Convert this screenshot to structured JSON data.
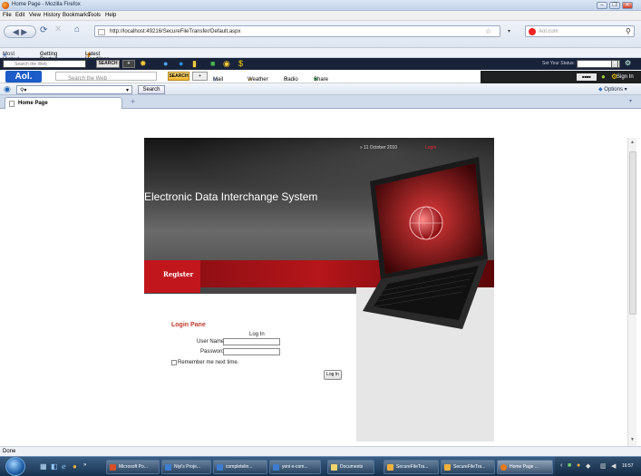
{
  "window": {
    "title": "Home Page - Mozilla Firefox"
  },
  "menu": [
    "File",
    "Edit",
    "View",
    "History",
    "Bookmarks",
    "Tools",
    "Help"
  ],
  "nav": {
    "url": "http://localhost:49216/SecureFileTransfer/Default.aspx",
    "search_placeholder": "Aol.com"
  },
  "bookmarks": [
    "Most Visited",
    "Getting Started",
    "Latest Headlines"
  ],
  "toolbar1": {
    "search_placeholder": "Search the Web",
    "search_btn": "SEARCH",
    "status_label": "Set Your Status:"
  },
  "toolbar2": {
    "logo": "Aol.",
    "search_placeholder": "Search the Web",
    "search_btn": "SEARCH",
    "mail": "Mail ▾",
    "weather": "Weather",
    "radio": "Radio",
    "share": "Share",
    "sign_in": "Sign In"
  },
  "toolbar3": {
    "search_btn": "Search",
    "options": "Options ▾"
  },
  "tab": {
    "label": "Home Page",
    "new_tab": "+"
  },
  "page": {
    "date": "11 October 2010",
    "login_link": "Login",
    "system_title": "Electronic Data Interchange System",
    "register": "Register",
    "login_pane_title": "Login Pane",
    "log_in_heading": "Log In",
    "username_label": "User Name:",
    "password_label": "Password:",
    "remember_label": "Remember me next time.",
    "login_button": "Log In"
  },
  "status": {
    "text": "Done"
  },
  "taskbar": {
    "items": [
      "Microsoft Po...",
      "Niyi's Proje...",
      "completelin...",
      "yeni e-com...",
      "Documents",
      "SecureFileTra...",
      "SecureFileTra...",
      "Home Page ..."
    ],
    "clock": "16:57"
  },
  "colors": {
    "accent_red": "#c2161d",
    "login_title": "#c0392b"
  }
}
